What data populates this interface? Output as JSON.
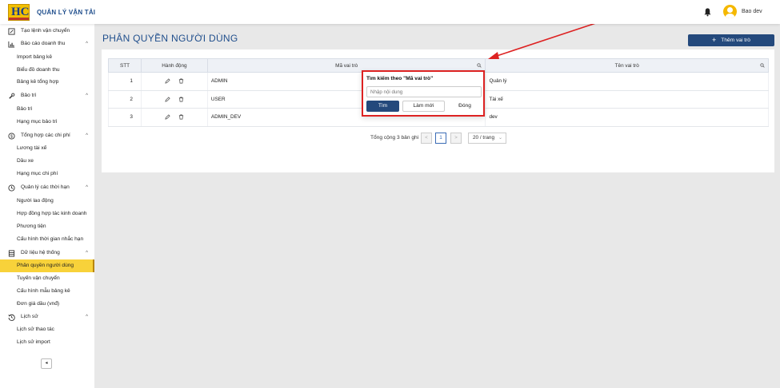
{
  "header": {
    "app_title": "QUẢN LÝ VẬN TẢI",
    "user_name": "Bao dev"
  },
  "sidebar": {
    "items": [
      {
        "label": "Tạo lệnh vận chuyển",
        "type": "top",
        "icon": "edit-square-icon"
      },
      {
        "label": "Báo cáo doanh thu",
        "type": "group",
        "icon": "bar-chart-icon",
        "chevron": "^"
      },
      {
        "label": "Import bảng kê",
        "type": "sub"
      },
      {
        "label": "Biểu đồ doanh thu",
        "type": "sub"
      },
      {
        "label": "Bảng kê tổng hợp",
        "type": "sub"
      },
      {
        "label": "Bảo trì",
        "type": "group",
        "icon": "wrench-icon",
        "chevron": "^"
      },
      {
        "label": "Bảo trì",
        "type": "sub"
      },
      {
        "label": "Hạng mục bảo trì",
        "type": "sub"
      },
      {
        "label": "Tổng hợp các chi phí",
        "type": "group",
        "icon": "dollar-icon",
        "chevron": "^"
      },
      {
        "label": "Lương tài xế",
        "type": "sub"
      },
      {
        "label": "Dầu xe",
        "type": "sub"
      },
      {
        "label": "Hạng mục chi phí",
        "type": "sub"
      },
      {
        "label": "Quản lý các thời hạn",
        "type": "group",
        "icon": "clock-icon",
        "chevron": "^"
      },
      {
        "label": "Người lao động",
        "type": "sub"
      },
      {
        "label": "Hợp đồng hợp tác kinh doanh",
        "type": "sub"
      },
      {
        "label": "Phương tiện",
        "type": "sub"
      },
      {
        "label": "Cấu hình thời gian nhắc hạn",
        "type": "sub"
      },
      {
        "label": "Dữ liệu hệ thống",
        "type": "group",
        "icon": "database-icon",
        "chevron": "^"
      },
      {
        "label": "Phân quyền người dùng",
        "type": "sub",
        "active": true
      },
      {
        "label": "Tuyến vận chuyển",
        "type": "sub"
      },
      {
        "label": "Cấu hình mẫu bảng kê",
        "type": "sub"
      },
      {
        "label": "Đơn giá dầu (vnđ)",
        "type": "sub"
      },
      {
        "label": "Lịch sử",
        "type": "group",
        "icon": "history-icon",
        "chevron": "^"
      },
      {
        "label": "Lịch sử thao tác",
        "type": "sub"
      },
      {
        "label": "Lịch sử import",
        "type": "sub"
      }
    ],
    "collapse_label": "◂"
  },
  "main": {
    "page_title": "PHÂN QUYỀN NGƯỜI DÙNG",
    "add_button": "Thêm vai trò",
    "table": {
      "columns": [
        "STT",
        "Hành động",
        "Mã vai trò",
        "Tên vai trò"
      ],
      "rows": [
        {
          "stt": "1",
          "code": "ADMIN",
          "name": "Quản lý"
        },
        {
          "stt": "2",
          "code": "USER",
          "name": "Tài xế"
        },
        {
          "stt": "3",
          "code": "ADMIN_DEV",
          "name": "dev"
        }
      ]
    },
    "pagination": {
      "total_text": "Tổng cộng 3 bản ghi",
      "current_page": "1",
      "page_size": "20 / trang",
      "prev": "<",
      "next": ">"
    }
  },
  "search_popover": {
    "title": "Tìm kiếm theo \"Mã vai trò\"",
    "placeholder": "Nhập nội dung",
    "search_button": "Tìm",
    "reset_button": "Làm mới",
    "close_button": "Đóng"
  },
  "colors": {
    "primary": "#24497c",
    "accent": "#f8d23a",
    "annotation": "#dd2222"
  }
}
